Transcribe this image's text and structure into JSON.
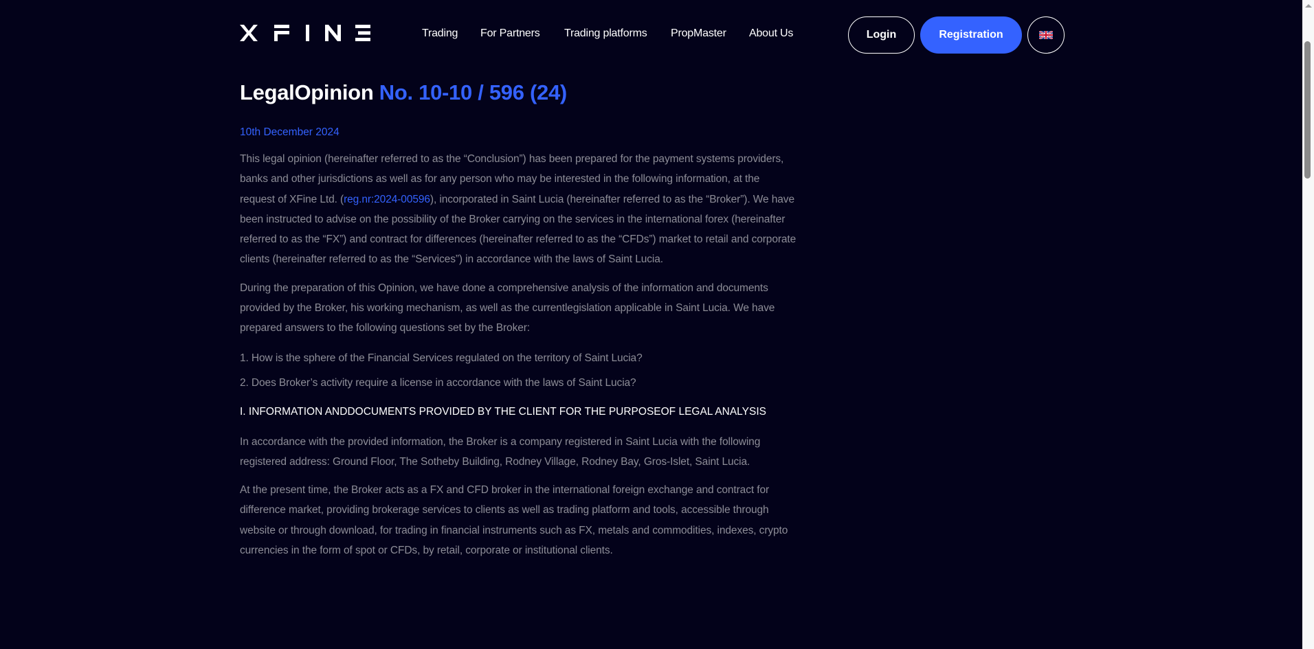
{
  "header": {
    "logo_text": "XFINE",
    "nav": [
      "Trading",
      "For Partners",
      "Trading platforms",
      "PropMaster",
      "About Us"
    ],
    "login_label": "Login",
    "registration_label": "Registration",
    "language_icon": "uk-flag-icon"
  },
  "colors": {
    "background": "#03021a",
    "accent": "#3462ff",
    "body_text": "#8d8d97"
  },
  "article": {
    "title": "LegalOpinion",
    "title_number": "No. 10-10 / 596 (24)",
    "date": "10th December 2024",
    "p1_a": "This legal opinion (hereinafter referred to as the “Conclusion”) has been prepared for the payment systems providers, banks and other jurisdictions as well as for any person who may be interested in the following information, at the request of XFine Ltd. (",
    "p1_link": "reg.nr:2024-00596",
    "p1_b": "), incorporated in Saint Lucia (hereinafter referred to as the “Broker”). We have been instructed to advise on the possibility of the Broker carrying on the services in the international forex (hereinafter referred to as the “FX”) and contract for differences (hereinafter referred to as the “CFDs”) market to retail and corporate clients (hereinafter referred to as the “Services”) in accordance with the laws of Saint Lucia.",
    "p2": "During the preparation of this Opinion, we have done a comprehensive analysis of the information and documents provided by the Broker, his working mechanism, as well as the currentlegislation applicable in Saint Lucia. We have prepared answers to the following questions set by the Broker:",
    "q1": "1. How is the sphere of the Financial Services regulated on the territory of Saint Lucia?",
    "q2": "2. Does Broker’s activity require a license in accordance with the laws of Saint Lucia?",
    "section1": "I. INFORMATION ANDDOCUMENTS PROVIDED BY THE CLIENT FOR THE PURPOSEOF LEGAL ANALYSIS",
    "p3": "In accordance with the provided information, the Broker is a company registered in Saint Lucia with the following registered address: Ground Floor, The Sotheby Building, Rodney Village, Rodney Bay, Gros-Islet, Saint Lucia.",
    "p4": "At the present time, the Broker acts as a FX and CFD broker in the international foreign exchange and contract for difference market, providing brokerage services to clients as well as trading platform and tools, accessible through website or through download, for trading in financial instruments such as FX, metals and commodities, indexes, crypto currencies in the form of spot or CFDs, by retail, corporate or institutional clients."
  }
}
